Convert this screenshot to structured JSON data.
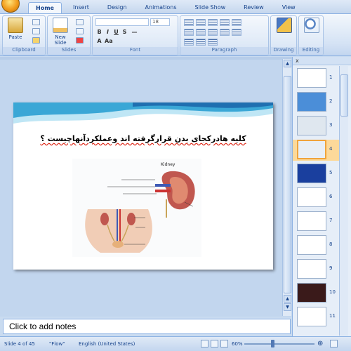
{
  "ribbon": {
    "tabs": [
      "Home",
      "Insert",
      "Design",
      "Animations",
      "Slide Show",
      "Review",
      "View"
    ],
    "active_tab": "Home",
    "groups": {
      "clipboard": {
        "label": "Clipboard",
        "paste_label": "Paste"
      },
      "slides": {
        "label": "Slides",
        "new_slide_label": "New Slide"
      },
      "font": {
        "label": "Font",
        "size_value": "18"
      },
      "paragraph": {
        "label": "Paragraph"
      },
      "drawing": {
        "label": "Drawing"
      },
      "editing": {
        "label": "Editing"
      }
    }
  },
  "slide": {
    "title": "کلیه هادرکجای بدن قرارگرفته اند وعملکردآنهاچیست ؟",
    "figure_labels": {
      "kidney": "Kidney"
    }
  },
  "notes": {
    "placeholder": "Click to add notes"
  },
  "thumbnails": [
    {
      "num": "1",
      "selected": false,
      "color": "#ffffff"
    },
    {
      "num": "2",
      "selected": false,
      "color": "#4b8ed8"
    },
    {
      "num": "3",
      "selected": false,
      "color": "#dfe7ef"
    },
    {
      "num": "4",
      "selected": true,
      "color": "#e8eef5"
    },
    {
      "num": "5",
      "selected": false,
      "color": "#1a3f9e"
    },
    {
      "num": "6",
      "selected": false,
      "color": "#ffffff"
    },
    {
      "num": "7",
      "selected": false,
      "color": "#ffffff"
    },
    {
      "num": "8",
      "selected": false,
      "color": "#ffffff"
    },
    {
      "num": "9",
      "selected": false,
      "color": "#ffffff"
    },
    {
      "num": "10",
      "selected": false,
      "color": "#3a1a1a"
    },
    {
      "num": "11",
      "selected": false,
      "color": "#ffffff"
    }
  ],
  "status": {
    "slide_info": "Slide 4 of 45",
    "theme": "\"Flow\"",
    "language": "English (United States)",
    "zoom": "60%"
  }
}
